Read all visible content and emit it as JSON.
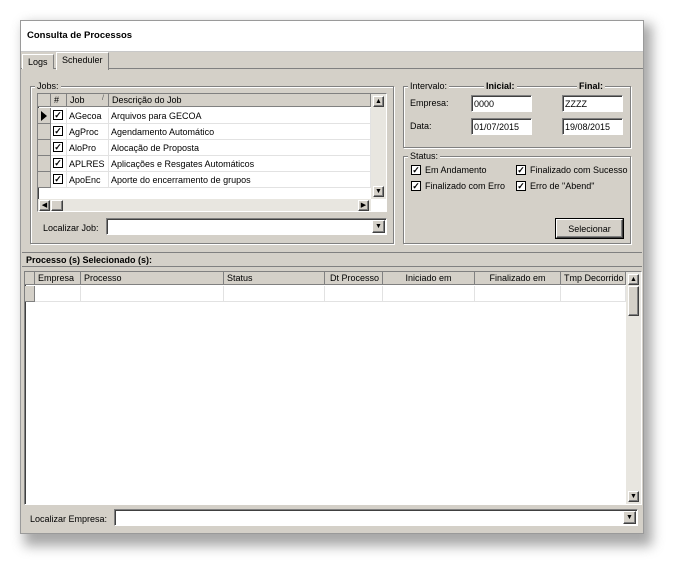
{
  "window": {
    "title": "Consulta de Processos"
  },
  "tabs": [
    {
      "label": "Logs"
    },
    {
      "label": "Scheduler"
    }
  ],
  "jobs": {
    "legend": "Jobs:",
    "columns": {
      "check": "#",
      "job": "Job",
      "sort": "/",
      "desc": "Descrição do Job"
    },
    "rows": [
      {
        "job": "AGecoa",
        "desc": "Arquivos para GECOA"
      },
      {
        "job": "AgProc",
        "desc": "Agendamento Automático"
      },
      {
        "job": "AloPro",
        "desc": "Alocação de Proposta"
      },
      {
        "job": "APLRES",
        "desc": "Aplicações e Resgates Automáticos"
      },
      {
        "job": "ApoEnc",
        "desc": "Aporte do encerramento de grupos"
      }
    ],
    "search_label": "Localizar Job:",
    "search_value": ""
  },
  "intervalo": {
    "legend": "Intervalo:",
    "inicial_label": "Inicial:",
    "final_label": "Final:",
    "empresa_label": "Empresa:",
    "empresa_inicial": "0000",
    "empresa_final": "ZZZZ",
    "data_label": "Data:",
    "data_inicial": "01/07/2015",
    "data_final": "19/08/2015"
  },
  "status": {
    "legend": "Status:",
    "em_andamento": "Em Andamento",
    "finalizado_sucesso": "Finalizado com Sucesso",
    "finalizado_erro": "Finalizado com Erro",
    "erro_abend": "Erro de \"Abend\"",
    "select_button": "Selecionar"
  },
  "processos": {
    "title": "Processo (s) Selecionado (s):",
    "columns": {
      "empresa": "Empresa",
      "processo": "Processo",
      "status": "Status",
      "dt_processo": "Dt Processo",
      "iniciado": "Iniciado em",
      "finalizado": "Finalizado em",
      "tmp": "Tmp Decorrido"
    },
    "search_label": "Localizar Empresa:",
    "search_value": ""
  }
}
